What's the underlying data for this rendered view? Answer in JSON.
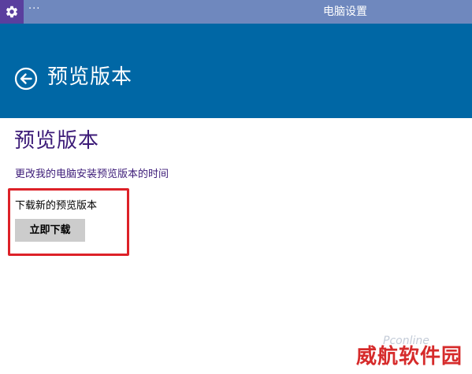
{
  "titlebar": {
    "app_icon": "gear-icon",
    "menu_label": "···",
    "title": "电脑设置"
  },
  "header": {
    "back_icon": "back-arrow-icon",
    "title": "预览版本"
  },
  "content": {
    "page_title": "预览版本",
    "change_link": "更改我的电脑安装预览版本的时间",
    "download_label": "下载新的预览版本",
    "download_button": "立即下载"
  },
  "watermarks": {
    "pconline": "Pconline",
    "site": "威航软件园"
  },
  "colors": {
    "titlebar": "#6f88be",
    "app_icon_bg": "#5a3f9e",
    "header": "#0067a5",
    "accent_text": "#3c1b78",
    "highlight": "#dd2128",
    "button": "#cccccc"
  }
}
